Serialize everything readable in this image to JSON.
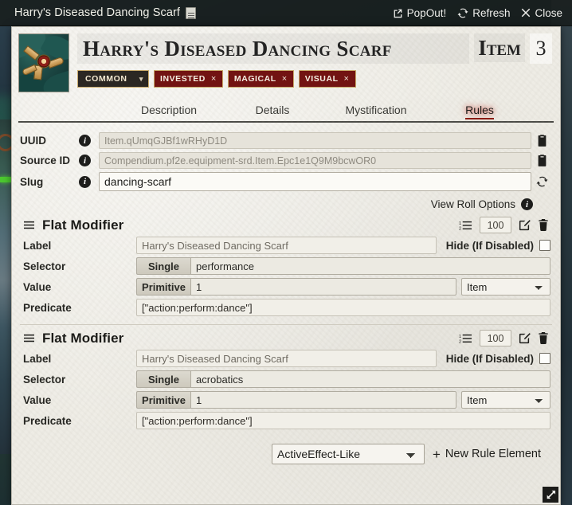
{
  "window": {
    "title": "Harry's Diseased Dancing Scarf",
    "title_icon": "journal-icon",
    "controls": [
      {
        "label": "PopOut!",
        "icon": "popout-icon"
      },
      {
        "label": "Refresh",
        "icon": "refresh-icon"
      },
      {
        "label": "Close",
        "icon": "close-icon"
      }
    ]
  },
  "header": {
    "item_name": "Harry's Diseased Dancing Scarf",
    "item_word": "Item",
    "item_count": "3",
    "image_alt": "brooch-item-icon",
    "rarity": "Common",
    "rarity_display": "COMMON",
    "traits": [
      {
        "label": "INVESTED",
        "remove": "×"
      },
      {
        "label": "MAGICAL",
        "remove": "×"
      },
      {
        "label": "VISUAL",
        "remove": "×"
      }
    ]
  },
  "tabs": [
    {
      "label": "Description",
      "active": false
    },
    {
      "label": "Details",
      "active": false
    },
    {
      "label": "Mystification",
      "active": false
    },
    {
      "label": "Rules",
      "active": true
    }
  ],
  "identifiers": {
    "uuid": {
      "label": "UUID",
      "value": "Item.qUmqGJBf1wRHyD1D",
      "action_icon": "clipboard-icon"
    },
    "source_id": {
      "label": "Source ID",
      "value": "Compendium.pf2e.equipment-srd.Item.Epc1e1Q9M9bcwOR0",
      "action_icon": "clipboard-icon"
    },
    "slug": {
      "label": "Slug",
      "value": "dancing-scarf",
      "action_icon": "regenerate-icon"
    },
    "view_roll_options": "View Roll Options"
  },
  "field_labels": {
    "label": "Label",
    "selector": "Selector",
    "value": "Value",
    "predicate": "Predicate",
    "hide_if_disabled": "Hide (If Disabled)"
  },
  "rules": [
    {
      "title": "Flat Modifier",
      "priority": "100",
      "label": "Harry's Diseased Dancing Scarf",
      "selector_mode": "Single",
      "selector": "performance",
      "value_mode": "Primitive",
      "value": "1",
      "type": "Item",
      "predicate": "[\"action:perform:dance\"]",
      "hide_if_disabled": false
    },
    {
      "title": "Flat Modifier",
      "priority": "100",
      "label": "Harry's Diseased Dancing Scarf",
      "selector_mode": "Single",
      "selector": "acrobatics",
      "value_mode": "Primitive",
      "value": "1",
      "type": "Item",
      "predicate": "[\"action:perform:dance\"]",
      "hide_if_disabled": false
    }
  ],
  "footer": {
    "new_rule_type": "ActiveEffect-Like",
    "new_rule_button": "New Rule Element",
    "plus": "+"
  },
  "colors": {
    "sheet_bg": "#eeece5",
    "trait_chip": "#721312",
    "trait_border": "#c8a96a",
    "active_tab": "#8c1f16",
    "titlebar": "#181e1d"
  }
}
